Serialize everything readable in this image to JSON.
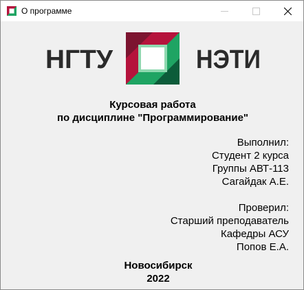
{
  "window": {
    "title": "О программе",
    "controls": [
      "minimize-icon",
      "maximize-icon",
      "close-icon"
    ]
  },
  "logo": {
    "left_text": "НГТУ",
    "right_text": "НЭТИ",
    "colors": {
      "text": "#2b2b2b",
      "crimson": "#b5133c",
      "dark_red": "#7c1430",
      "green": "#1fa463",
      "dark_green": "#0c5c3a",
      "white": "#ffffff"
    }
  },
  "course": {
    "line1": "Курсовая работа",
    "line2": "по дисциплине \"Программирование\""
  },
  "performed": {
    "heading": "Выполнил:",
    "role": "Студент 2 курса",
    "group": "Группы АВТ-113",
    "name": "Сагайдак А.Е."
  },
  "checked": {
    "heading": "Проверил:",
    "role": "Старший преподаватель",
    "department": "Кафедры АСУ",
    "name": "Попов Е.А."
  },
  "footer": {
    "city": "Новосибирск",
    "year": "2022"
  }
}
